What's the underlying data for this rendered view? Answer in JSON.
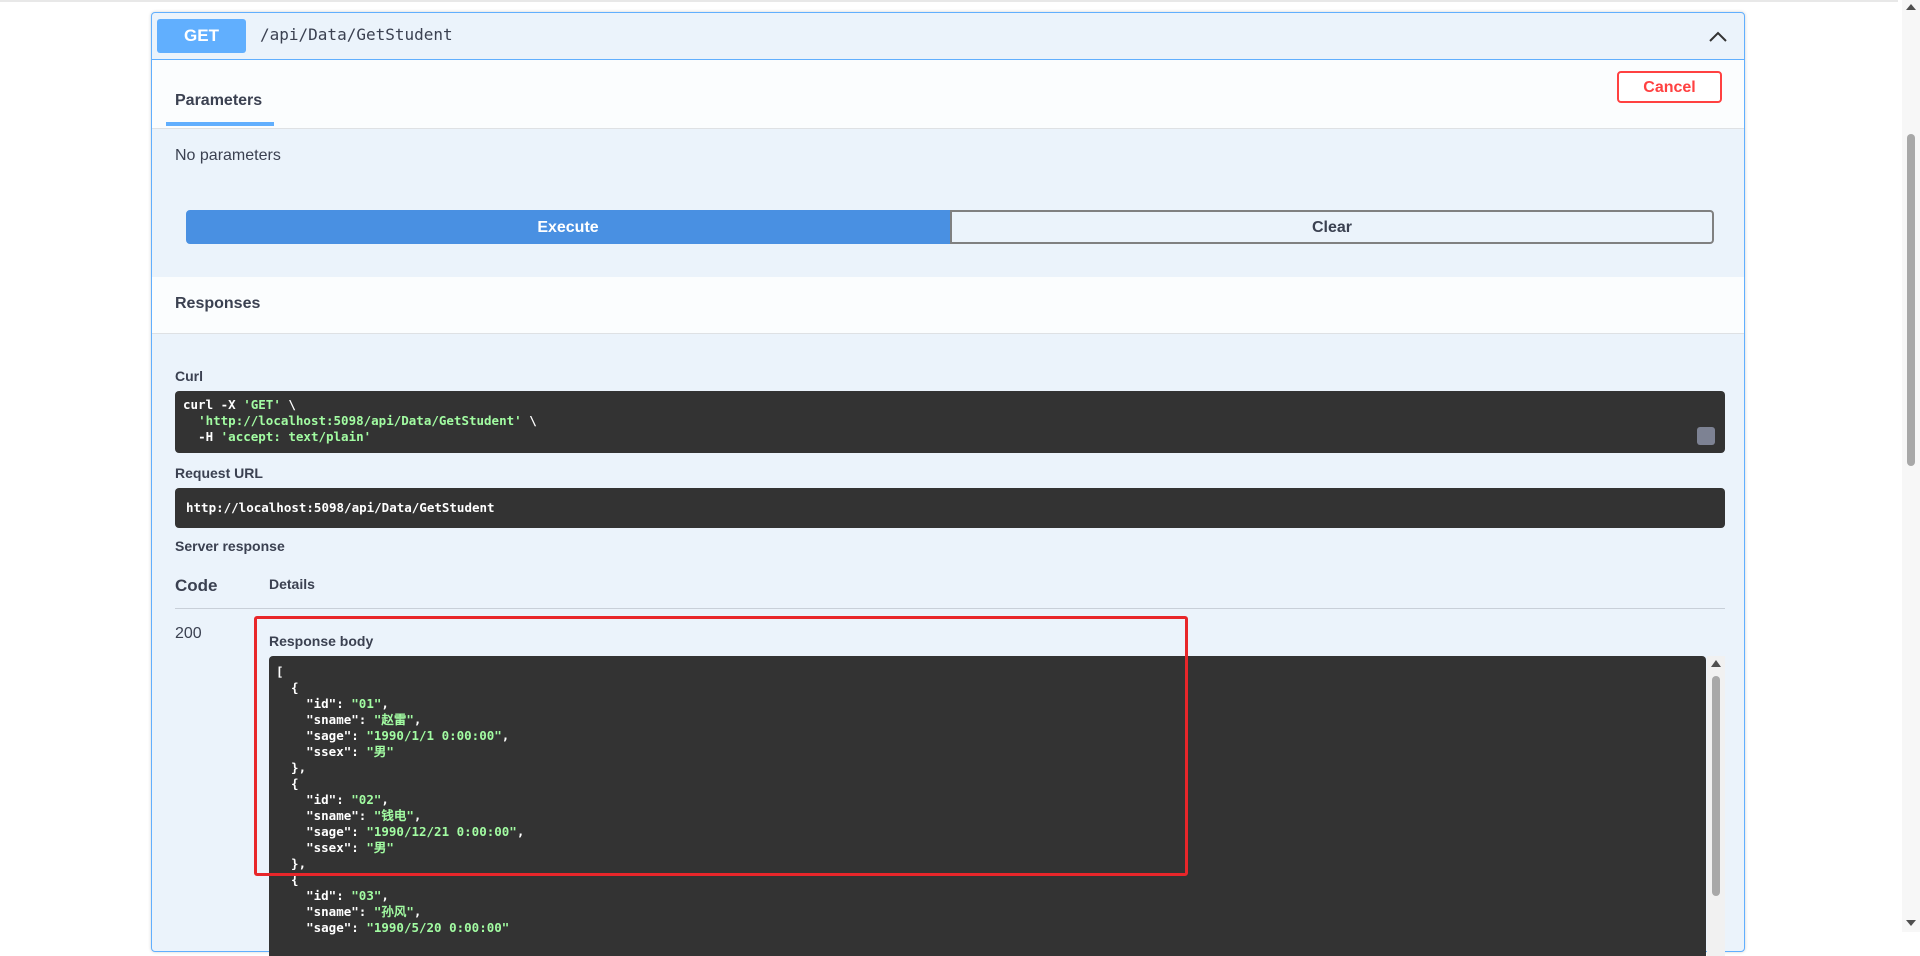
{
  "operation": {
    "method": "GET",
    "path": "/api/Data/GetStudent"
  },
  "parameters": {
    "tab_label": "Parameters",
    "cancel_label": "Cancel",
    "empty_text": "No parameters"
  },
  "actions": {
    "execute_label": "Execute",
    "clear_label": "Clear"
  },
  "responses": {
    "title": "Responses",
    "curl_label": "Curl",
    "curl_line1_prefix": "curl -X ",
    "curl_line1_method": "'GET'",
    "curl_line1_suffix": " \\",
    "curl_line2_url": "'http://localhost:5098/api/Data/GetStudent'",
    "curl_line2_suffix": " \\",
    "curl_line3_prefix": "-H ",
    "curl_line3_header": "'accept: text/plain'",
    "request_url_label": "Request URL",
    "request_url": "http://localhost:5098/api/Data/GetStudent",
    "server_response_label": "Server response",
    "col_code": "Code",
    "col_details": "Details",
    "status_code": "200",
    "response_body_label": "Response body"
  },
  "response_body": {
    "students": [
      {
        "id": "01",
        "sname": "赵雷",
        "sage": "1990/1/1 0:00:00",
        "ssex": "男"
      },
      {
        "id": "02",
        "sname": "钱电",
        "sage": "1990/12/21 0:00:00",
        "ssex": "男"
      },
      {
        "id": "03",
        "sname": "孙风",
        "sage": "1990/5/20 0:00:00"
      }
    ]
  },
  "icons": {
    "collapse": "chevron-up-icon",
    "copy": "copy-to-clipboard-icon"
  },
  "colors": {
    "get_method": "#61affe",
    "execute": "#4990e2",
    "cancel": "#ff4141",
    "code_bg": "#333333",
    "json_string": "#a2fca2",
    "highlight": "#e8262a"
  }
}
